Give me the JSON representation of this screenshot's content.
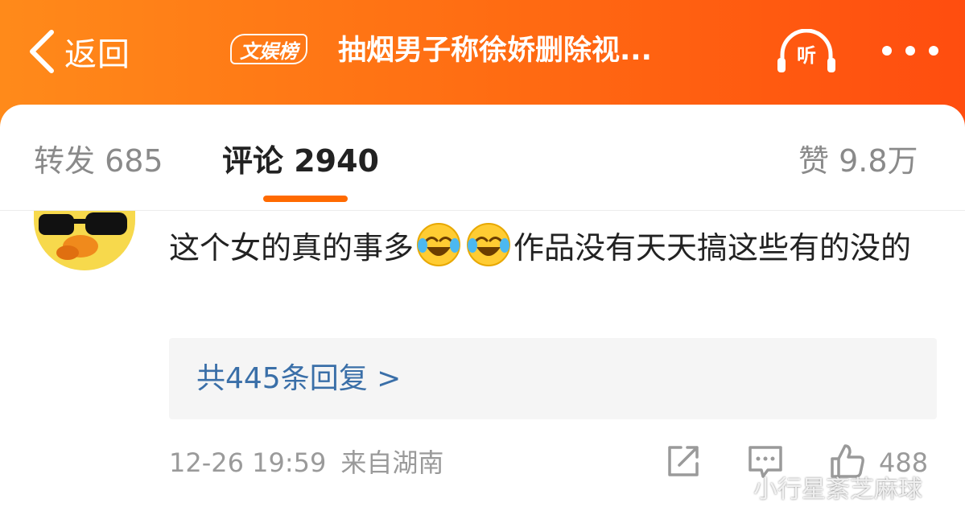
{
  "header": {
    "back_label": "返回",
    "tag_label": "文娱榜",
    "title": "抽烟男子称徐娇删除视...",
    "listen_label": "听"
  },
  "tabs": {
    "repost": "转发 685",
    "comment": "评论 2940",
    "like": "赞 9.8万",
    "active": "comment"
  },
  "comment": {
    "text_part1": "这个女的真的事多",
    "emojis": [
      "laugh-cry-emoji",
      "laugh-cry-emoji"
    ],
    "text_part2": "作品没有天天搞这些有的没的",
    "replies_label": "共445条回复 >",
    "time": "12-26 19:59",
    "location": "来自湖南",
    "like_count": "488"
  },
  "watermark": "小行星紊芝麻球",
  "colors": {
    "header_start": "#ff8a1a",
    "header_end": "#ff4d0f",
    "tab_indicator": "#ff6a00",
    "reply_link": "#3a6fa8",
    "meta_text": "#9a9a9a"
  }
}
